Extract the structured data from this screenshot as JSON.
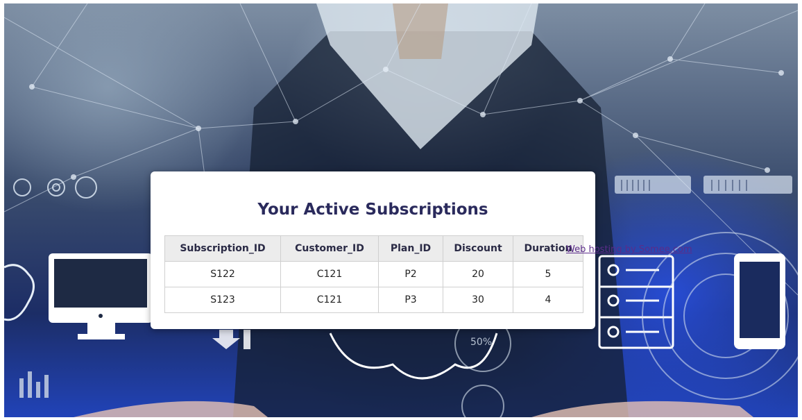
{
  "page": {
    "title": "Your Active Subscriptions",
    "credit_link": "Web hosting by Somee.com"
  },
  "table": {
    "headers": [
      "Subscription_ID",
      "Customer_ID",
      "Plan_ID",
      "Discount",
      "Duration"
    ],
    "rows": [
      [
        "S122",
        "C121",
        "P2",
        "20",
        "5"
      ],
      [
        "S123",
        "C121",
        "P3",
        "30",
        "4"
      ]
    ]
  },
  "background": {
    "badge_text": "50%"
  },
  "colors": {
    "title": "#2a2a5c",
    "header_bg": "#ececec",
    "link": "#5b2c8a",
    "accent_blue": "#2143b8"
  }
}
